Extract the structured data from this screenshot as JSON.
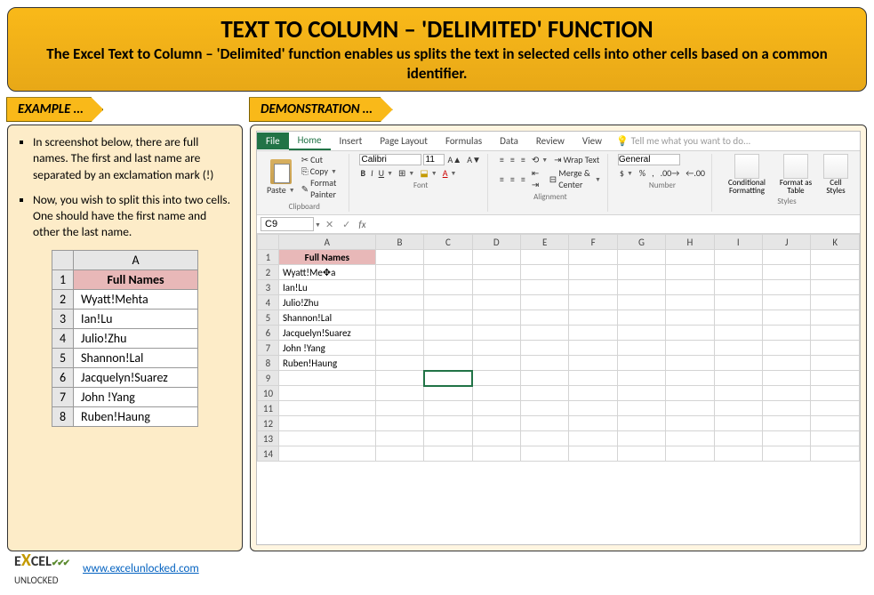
{
  "header": {
    "title": "TEXT TO COLUMN – 'DELIMITED' FUNCTION",
    "subtitle": "The Excel Text to Column – 'Delimited' function enables us splits the text in selected cells into other cells based on a common identifier."
  },
  "example": {
    "tab": "EXAMPLE …",
    "bullets": [
      "In screenshot below, there are full names. The first and last name are separated by an exclamation mark (!)",
      "Now, you wish to split this into two cells. One should have the first name and other the last name."
    ],
    "table_header": "Full Names",
    "col_letter": "A",
    "rows": [
      "Wyatt!Mehta",
      "Ian!Lu",
      "Julio!Zhu",
      "Shannon!Lal",
      "Jacquelyn!Suarez",
      "John !Yang",
      "Ruben!Haung"
    ]
  },
  "demo": {
    "tab": "DEMONSTRATION …"
  },
  "excel": {
    "tabs": [
      "File",
      "Home",
      "Insert",
      "Page Layout",
      "Formulas",
      "Data",
      "Review",
      "View"
    ],
    "tellme": "Tell me what you want to do...",
    "clipboard": {
      "paste": "Paste",
      "cut": "Cut",
      "copy": "Copy ",
      "painter": "Format Painter",
      "title": "Clipboard"
    },
    "font": {
      "name": "Calibri",
      "size": "11",
      "title": "Font"
    },
    "alignment": {
      "wrap": "Wrap Text",
      "merge": "Merge & Center",
      "title": "Alignment"
    },
    "number": {
      "general": "General",
      "title": "Number"
    },
    "styles": {
      "cond": "Conditional Formatting",
      "fmt": "Format as Table",
      "cell": "Cell Styles",
      "title": "Styles"
    },
    "namebox": "C9",
    "columns": [
      "A",
      "B",
      "C",
      "D",
      "E",
      "F",
      "G",
      "H",
      "I",
      "J",
      "K"
    ],
    "header_cell": "Full Names",
    "data": [
      "Wyatt!Me✥a",
      "Ian!Lu",
      "Julio!Zhu",
      "Shannon!Lal",
      "Jacquelyn!Suarez",
      "John !Yang",
      "Ruben!Haung"
    ],
    "row_count": 14,
    "selected": "C9"
  },
  "footer": {
    "brand_prefix": "E",
    "brand_mid": "CEL",
    "brand_suffix": "UNLOCKED",
    "link": "www.excelunlocked.com"
  }
}
